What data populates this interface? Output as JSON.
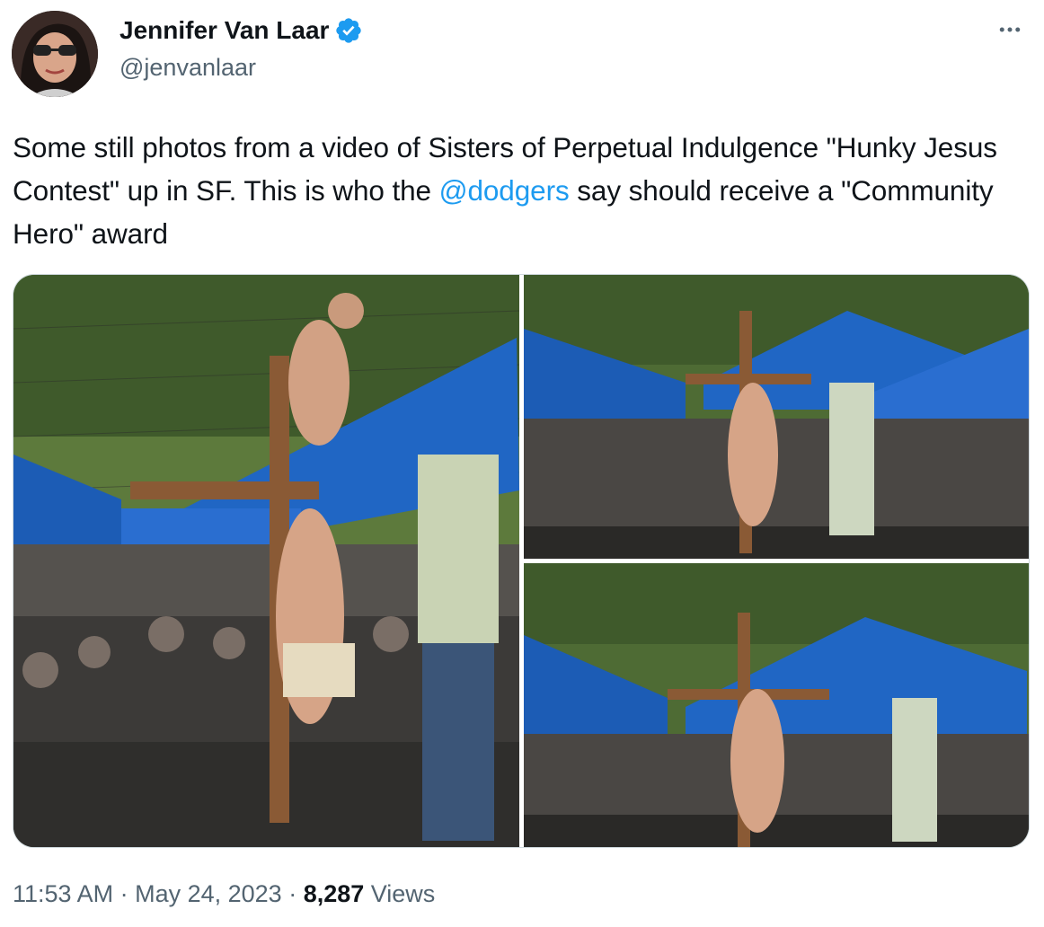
{
  "author": {
    "name": "Jennifer Van Laar",
    "handle": "@jenvanlaar",
    "verified_color": "#1d9bf0"
  },
  "tweet": {
    "text_part1": "Some still photos from a video of Sisters of Perpetual Indulgence \"Hunky Jesus Contest\" up in SF. This is who the ",
    "mention": "@dodgers",
    "text_part2": " say should receive a \"Community Hero\" award"
  },
  "meta": {
    "time": "11:53 AM",
    "separator": " · ",
    "date": "May 24, 2023",
    "views_count": "8,287",
    "views_label": " Views"
  },
  "icons": {
    "more": "more-horizontal-icon",
    "verified": "verified-badge-icon"
  },
  "colors": {
    "text": "#0f1419",
    "secondary": "#536471",
    "link": "#1d9bf0"
  }
}
